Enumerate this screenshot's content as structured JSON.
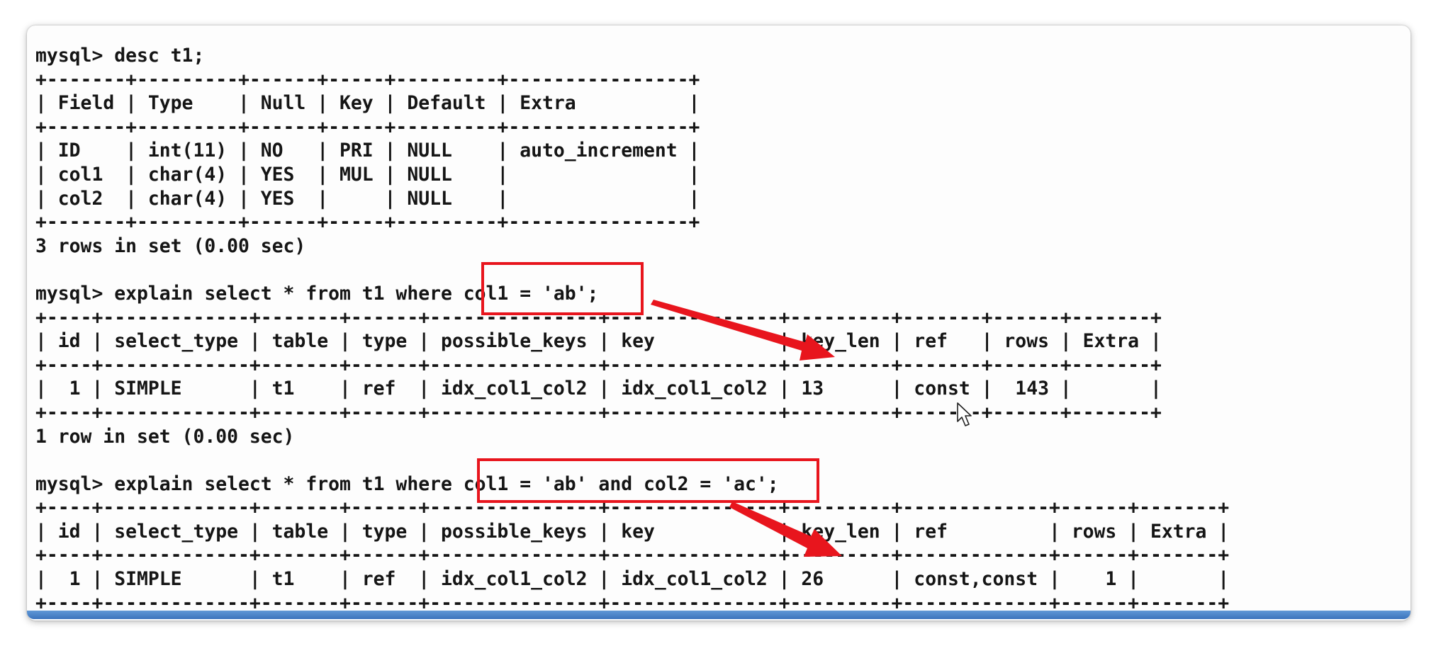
{
  "terminal": {
    "lines": [
      "mysql> desc t1;",
      "+-------+---------+------+-----+---------+----------------+",
      "| Field | Type    | Null | Key | Default | Extra          |",
      "+-------+---------+------+-----+---------+----------------+",
      "| ID    | int(11) | NO   | PRI | NULL    | auto_increment |",
      "| col1  | char(4) | YES  | MUL | NULL    |                |",
      "| col2  | char(4) | YES  |     | NULL    |                |",
      "+-------+---------+------+-----+---------+----------------+",
      "3 rows in set (0.00 sec)",
      "",
      "mysql> explain select * from t1 where col1 = 'ab';",
      "+----+-------------+-------+------+---------------+---------------+---------+-------+------+-------+",
      "| id | select_type | table | type | possible_keys | key           | key_len | ref   | rows | Extra |",
      "+----+-------------+-------+------+---------------+---------------+---------+-------+------+-------+",
      "|  1 | SIMPLE      | t1    | ref  | idx_col1_col2 | idx_col1_col2 | 13      | const |  143 |       |",
      "+----+-------------+-------+------+---------------+---------------+---------+-------+------+-------+",
      "1 row in set (0.00 sec)",
      "",
      "mysql> explain select * from t1 where col1 = 'ab' and col2 = 'ac';",
      "+----+-------------+-------+------+---------------+---------------+---------+-------------+------+-------+",
      "| id | select_type | table | type | possible_keys | key           | key_len | ref         | rows | Extra |",
      "+----+-------------+-------+------+---------------+---------------+---------+-------------+------+-------+",
      "|  1 | SIMPLE      | t1    | ref  | idx_col1_col2 | idx_col1_col2 | 26      | const,const |    1 |       |",
      "+----+-------------+-------+------+---------------+---------------+---------+-------------+------+-------+"
    ]
  },
  "annotations": {
    "box_color": "#e8151d",
    "arrow_color": "#e8151d"
  }
}
